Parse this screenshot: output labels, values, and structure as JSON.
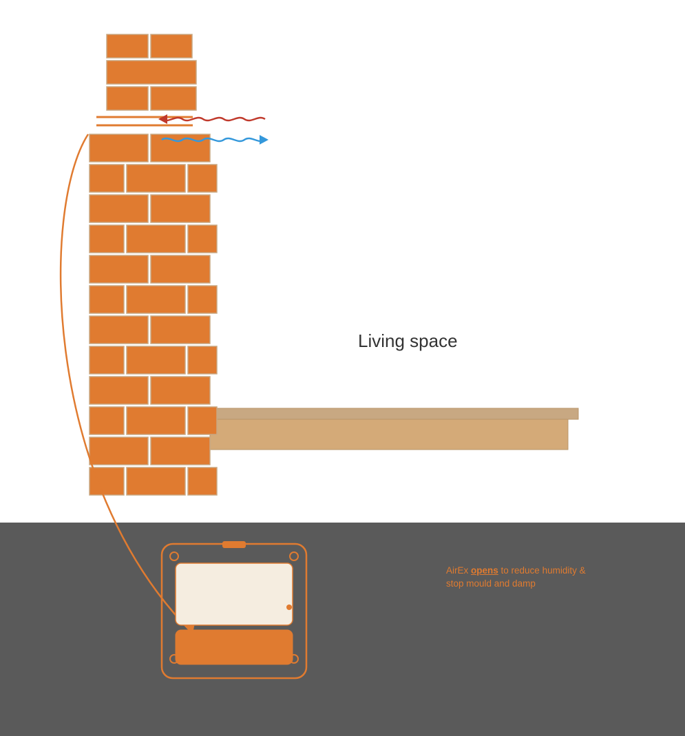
{
  "living_space": {
    "label": "Living space"
  },
  "airex_label": {
    "prefix": "AirEx ",
    "bold_word": "opens",
    "suffix": " to reduce humidity &\nstop mould and damp"
  },
  "colors": {
    "brick": "#E07B30",
    "mortar": "#c8a882",
    "beam": "#d4aa78",
    "dark_bg": "#5a5a5a",
    "orange_accent": "#E07B30",
    "wavy_red": "#c0392b",
    "wavy_blue": "#3498db",
    "text_dark": "#333333"
  }
}
